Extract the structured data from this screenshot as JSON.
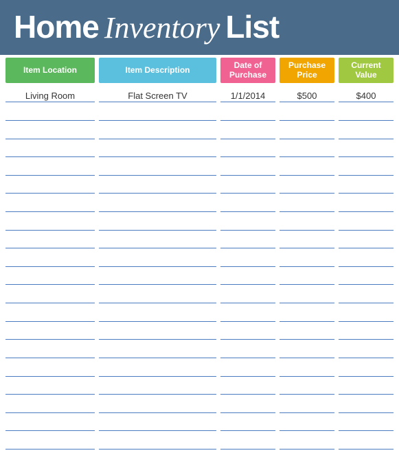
{
  "header": {
    "word1": "Home",
    "word2": "Inventory",
    "word3": "List"
  },
  "columns": {
    "location_label": "Item Location",
    "description_label": "Item Description",
    "date_label": "Date of Purchase",
    "price_label": "Purchase Price",
    "value_label": "Current Value"
  },
  "rows": [
    {
      "location": "Living Room",
      "description": "Flat Screen TV",
      "date": "1/1/2014",
      "price": "$500",
      "value": "$400"
    },
    {
      "location": "",
      "description": "",
      "date": "",
      "price": "",
      "value": ""
    },
    {
      "location": "",
      "description": "",
      "date": "",
      "price": "",
      "value": ""
    },
    {
      "location": "",
      "description": "",
      "date": "",
      "price": "",
      "value": ""
    },
    {
      "location": "",
      "description": "",
      "date": "",
      "price": "",
      "value": ""
    },
    {
      "location": "",
      "description": "",
      "date": "",
      "price": "",
      "value": ""
    },
    {
      "location": "",
      "description": "",
      "date": "",
      "price": "",
      "value": ""
    },
    {
      "location": "",
      "description": "",
      "date": "",
      "price": "",
      "value": ""
    },
    {
      "location": "",
      "description": "",
      "date": "",
      "price": "",
      "value": ""
    },
    {
      "location": "",
      "description": "",
      "date": "",
      "price": "",
      "value": ""
    },
    {
      "location": "",
      "description": "",
      "date": "",
      "price": "",
      "value": ""
    },
    {
      "location": "",
      "description": "",
      "date": "",
      "price": "",
      "value": ""
    },
    {
      "location": "",
      "description": "",
      "date": "",
      "price": "",
      "value": ""
    },
    {
      "location": "",
      "description": "",
      "date": "",
      "price": "",
      "value": ""
    },
    {
      "location": "",
      "description": "",
      "date": "",
      "price": "",
      "value": ""
    },
    {
      "location": "",
      "description": "",
      "date": "",
      "price": "",
      "value": ""
    },
    {
      "location": "",
      "description": "",
      "date": "",
      "price": "",
      "value": ""
    },
    {
      "location": "",
      "description": "",
      "date": "",
      "price": "",
      "value": ""
    },
    {
      "location": "",
      "description": "",
      "date": "",
      "price": "",
      "value": ""
    },
    {
      "location": "",
      "description": "",
      "date": "",
      "price": "",
      "value": ""
    }
  ]
}
